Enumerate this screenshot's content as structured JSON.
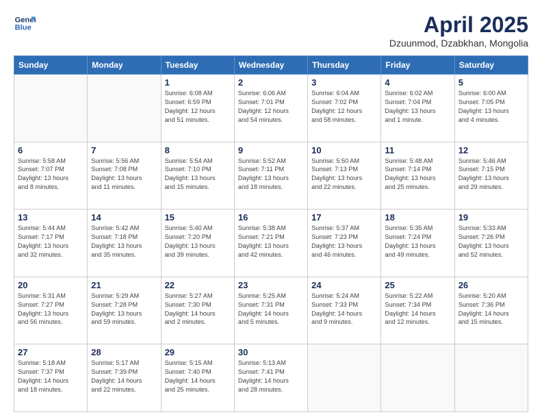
{
  "header": {
    "logo_line1": "General",
    "logo_line2": "Blue",
    "month": "April 2025",
    "location": "Dzuunmod, Dzabkhan, Mongolia"
  },
  "days_of_week": [
    "Sunday",
    "Monday",
    "Tuesday",
    "Wednesday",
    "Thursday",
    "Friday",
    "Saturday"
  ],
  "weeks": [
    [
      {
        "day": "",
        "info": ""
      },
      {
        "day": "",
        "info": ""
      },
      {
        "day": "1",
        "info": "Sunrise: 6:08 AM\nSunset: 6:59 PM\nDaylight: 12 hours\nand 51 minutes."
      },
      {
        "day": "2",
        "info": "Sunrise: 6:06 AM\nSunset: 7:01 PM\nDaylight: 12 hours\nand 54 minutes."
      },
      {
        "day": "3",
        "info": "Sunrise: 6:04 AM\nSunset: 7:02 PM\nDaylight: 12 hours\nand 58 minutes."
      },
      {
        "day": "4",
        "info": "Sunrise: 6:02 AM\nSunset: 7:04 PM\nDaylight: 13 hours\nand 1 minute."
      },
      {
        "day": "5",
        "info": "Sunrise: 6:00 AM\nSunset: 7:05 PM\nDaylight: 13 hours\nand 4 minutes."
      }
    ],
    [
      {
        "day": "6",
        "info": "Sunrise: 5:58 AM\nSunset: 7:07 PM\nDaylight: 13 hours\nand 8 minutes."
      },
      {
        "day": "7",
        "info": "Sunrise: 5:56 AM\nSunset: 7:08 PM\nDaylight: 13 hours\nand 11 minutes."
      },
      {
        "day": "8",
        "info": "Sunrise: 5:54 AM\nSunset: 7:10 PM\nDaylight: 13 hours\nand 15 minutes."
      },
      {
        "day": "9",
        "info": "Sunrise: 5:52 AM\nSunset: 7:11 PM\nDaylight: 13 hours\nand 18 minutes."
      },
      {
        "day": "10",
        "info": "Sunrise: 5:50 AM\nSunset: 7:13 PM\nDaylight: 13 hours\nand 22 minutes."
      },
      {
        "day": "11",
        "info": "Sunrise: 5:48 AM\nSunset: 7:14 PM\nDaylight: 13 hours\nand 25 minutes."
      },
      {
        "day": "12",
        "info": "Sunrise: 5:46 AM\nSunset: 7:15 PM\nDaylight: 13 hours\nand 29 minutes."
      }
    ],
    [
      {
        "day": "13",
        "info": "Sunrise: 5:44 AM\nSunset: 7:17 PM\nDaylight: 13 hours\nand 32 minutes."
      },
      {
        "day": "14",
        "info": "Sunrise: 5:42 AM\nSunset: 7:18 PM\nDaylight: 13 hours\nand 35 minutes."
      },
      {
        "day": "15",
        "info": "Sunrise: 5:40 AM\nSunset: 7:20 PM\nDaylight: 13 hours\nand 39 minutes."
      },
      {
        "day": "16",
        "info": "Sunrise: 5:38 AM\nSunset: 7:21 PM\nDaylight: 13 hours\nand 42 minutes."
      },
      {
        "day": "17",
        "info": "Sunrise: 5:37 AM\nSunset: 7:23 PM\nDaylight: 13 hours\nand 46 minutes."
      },
      {
        "day": "18",
        "info": "Sunrise: 5:35 AM\nSunset: 7:24 PM\nDaylight: 13 hours\nand 49 minutes."
      },
      {
        "day": "19",
        "info": "Sunrise: 5:33 AM\nSunset: 7:26 PM\nDaylight: 13 hours\nand 52 minutes."
      }
    ],
    [
      {
        "day": "20",
        "info": "Sunrise: 5:31 AM\nSunset: 7:27 PM\nDaylight: 13 hours\nand 56 minutes."
      },
      {
        "day": "21",
        "info": "Sunrise: 5:29 AM\nSunset: 7:28 PM\nDaylight: 13 hours\nand 59 minutes."
      },
      {
        "day": "22",
        "info": "Sunrise: 5:27 AM\nSunset: 7:30 PM\nDaylight: 14 hours\nand 2 minutes."
      },
      {
        "day": "23",
        "info": "Sunrise: 5:25 AM\nSunset: 7:31 PM\nDaylight: 14 hours\nand 5 minutes."
      },
      {
        "day": "24",
        "info": "Sunrise: 5:24 AM\nSunset: 7:33 PM\nDaylight: 14 hours\nand 9 minutes."
      },
      {
        "day": "25",
        "info": "Sunrise: 5:22 AM\nSunset: 7:34 PM\nDaylight: 14 hours\nand 12 minutes."
      },
      {
        "day": "26",
        "info": "Sunrise: 5:20 AM\nSunset: 7:36 PM\nDaylight: 14 hours\nand 15 minutes."
      }
    ],
    [
      {
        "day": "27",
        "info": "Sunrise: 5:18 AM\nSunset: 7:37 PM\nDaylight: 14 hours\nand 18 minutes."
      },
      {
        "day": "28",
        "info": "Sunrise: 5:17 AM\nSunset: 7:39 PM\nDaylight: 14 hours\nand 22 minutes."
      },
      {
        "day": "29",
        "info": "Sunrise: 5:15 AM\nSunset: 7:40 PM\nDaylight: 14 hours\nand 25 minutes."
      },
      {
        "day": "30",
        "info": "Sunrise: 5:13 AM\nSunset: 7:41 PM\nDaylight: 14 hours\nand 28 minutes."
      },
      {
        "day": "",
        "info": ""
      },
      {
        "day": "",
        "info": ""
      },
      {
        "day": "",
        "info": ""
      }
    ]
  ]
}
